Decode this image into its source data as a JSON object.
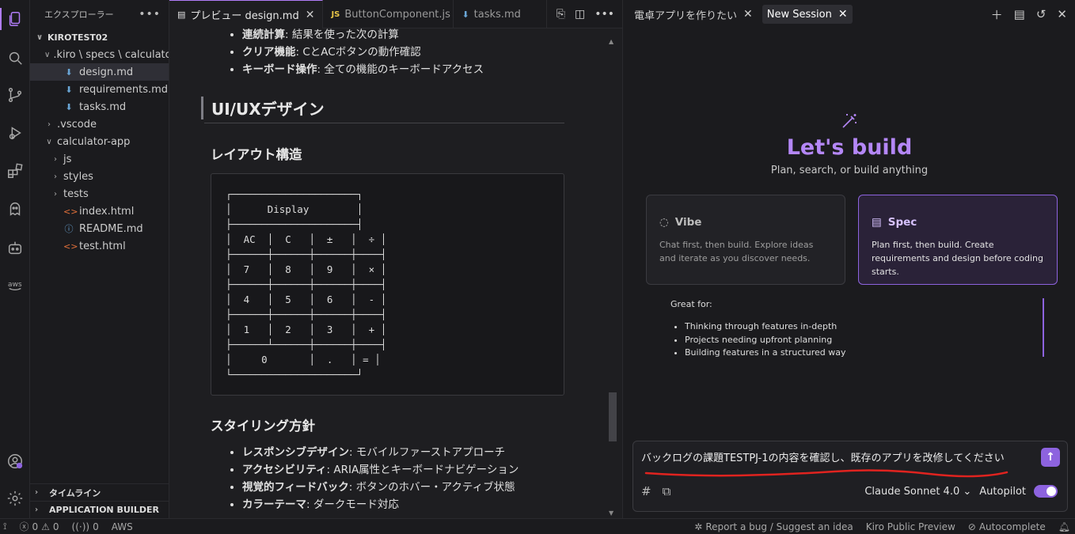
{
  "explorer": {
    "title": "エクスプローラー",
    "root": "KIROTEST02",
    "items": [
      {
        "label": ".kiro \\ specs \\ calculato...",
        "chev": "∨",
        "icon": "",
        "depth": 1
      },
      {
        "label": "design.md",
        "chev": "",
        "icon": "⬇",
        "depth": 2,
        "selected": true
      },
      {
        "label": "requirements.md",
        "chev": "",
        "icon": "⬇",
        "depth": 2
      },
      {
        "label": "tasks.md",
        "chev": "",
        "icon": "⬇",
        "depth": 2
      },
      {
        "label": ".vscode",
        "chev": "›",
        "icon": "",
        "depth": 1
      },
      {
        "label": "calculator-app",
        "chev": "∨",
        "icon": "",
        "depth": 1
      },
      {
        "label": "js",
        "chev": "›",
        "icon": "",
        "depth": 2
      },
      {
        "label": "styles",
        "chev": "›",
        "icon": "",
        "depth": 2
      },
      {
        "label": "tests",
        "chev": "›",
        "icon": "",
        "depth": 2
      },
      {
        "label": "index.html",
        "chev": "",
        "icon": "<>",
        "depth": 2
      },
      {
        "label": "README.md",
        "chev": "",
        "icon": "ⓘ",
        "depth": 2
      },
      {
        "label": "test.html",
        "chev": "",
        "icon": "<>",
        "depth": 2
      }
    ],
    "sections": {
      "timeline": "タイムライン",
      "app_builder": "APPLICATION BUILDER"
    }
  },
  "editor": {
    "tabs": [
      {
        "label": "プレビュー design.md",
        "active": true
      },
      {
        "label": "ButtonComponent.js",
        "active": false
      },
      {
        "label": "tasks.md",
        "active": false
      }
    ],
    "top_list": [
      {
        "bold": "連続計算",
        "text": ": 結果を使った次の計算"
      },
      {
        "bold": "クリア機能",
        "text": ": CとACボタンの動作確認"
      },
      {
        "bold": "キーボード操作",
        "text": ": 全ての機能のキーボードアクセス"
      }
    ],
    "h2": "UI/UXデザイン",
    "h3_layout": "レイアウト構造",
    "code": "┌─────────────────────┐\n│      Display        │\n├─────────────────────┤\n│  AC  │  C   │  ±   │  ÷ │\n├──────┼──────┼──────┼────┤\n│  7   │  8   │  9   │  × │\n├──────┼──────┼──────┼────┤\n│  4   │  5   │  6   │  - │\n├──────┼──────┼──────┼────┤\n│  1   │  2   │  3   │  + │\n├──────┴──────┼──────┼────┤\n│     0       │  .   │ = │\n└─────────────────────┘",
    "h3_style": "スタイリング方針",
    "bottom_list": [
      {
        "bold": "レスポンシブデザイン",
        "text": ": モバイルファーストアプローチ"
      },
      {
        "bold": "アクセシビリティ",
        "text": ": ARIA属性とキーボードナビゲーション"
      },
      {
        "bold": "視覚的フィードバック",
        "text": ": ボタンのホバー・アクティブ状態"
      },
      {
        "bold": "カラーテーマ",
        "text": ": ダークモード対応"
      }
    ]
  },
  "chat": {
    "tabs": [
      {
        "label": "電卓アプリを作りたい",
        "active": false
      },
      {
        "label": "New Session",
        "active": true
      }
    ],
    "heading": "Let's build",
    "subheading": "Plan, search, or build anything",
    "cards": [
      {
        "title": "Vibe",
        "desc": "Chat first, then build. Explore ideas and iterate as you discover needs.",
        "selected": false
      },
      {
        "title": "Spec",
        "desc": "Plan first, then build. Create requirements and design before coding starts.",
        "selected": true
      }
    ],
    "great_for": {
      "title": "Great for:",
      "items": [
        "Thinking through features in-depth",
        "Projects needing upfront planning",
        "Building features in a structured way"
      ]
    },
    "input": {
      "value": "バックログの課題TESTPJ-1の内容を確認し、既存のアプリを改修してください"
    },
    "model": "Claude Sonnet 4.0",
    "autopilot_label": "Autopilot",
    "autopilot_on": true
  },
  "status": {
    "errors": "0",
    "warnings": "0",
    "ports": "0",
    "aws": "AWS",
    "report": "Report a bug / Suggest an idea",
    "preview": "Kiro Public Preview",
    "autocomplete": "Autocomplete"
  },
  "colors": {
    "accent": "#b07cf7",
    "accent_dark": "#8d63df",
    "annotation_red": "#e0231f"
  }
}
